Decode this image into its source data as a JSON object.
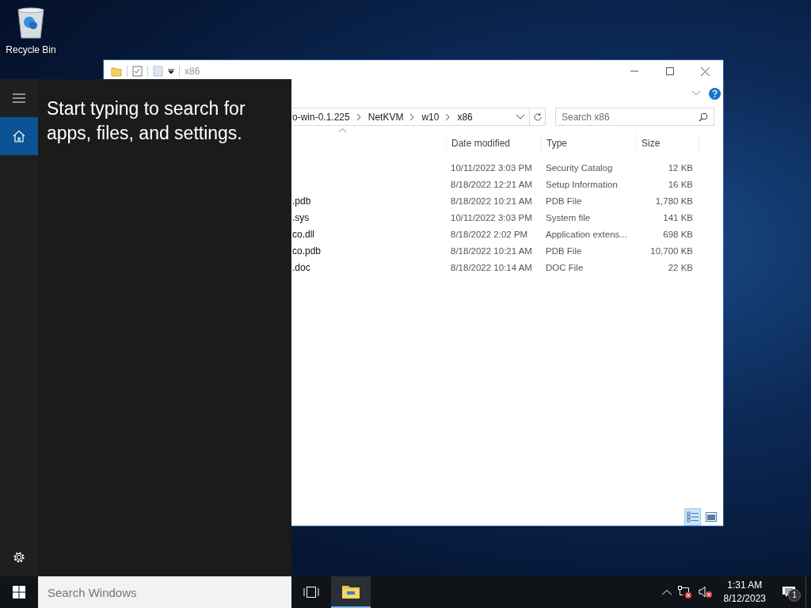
{
  "desktop": {
    "icons": [
      {
        "label": "Recycle Bin"
      }
    ]
  },
  "explorer": {
    "title": "x86",
    "breadcrumb": [
      "o-win-0.1.225",
      "NetKVM",
      "w10",
      "x86"
    ],
    "search": {
      "placeholder": "Search x86"
    },
    "columns": [
      "Date modified",
      "Type",
      "Size"
    ],
    "rows": [
      {
        "date": "10/11/2022 3:03 PM",
        "type": "Security Catalog",
        "size": "12 KB"
      },
      {
        "date": "8/18/2022 12:21 AM",
        "type": "Setup Information",
        "size": "16 KB"
      },
      {
        "name": ".pdb",
        "date": "8/18/2022 10:21 AM",
        "type": "PDB File",
        "size": "1,780 KB"
      },
      {
        "name": ".sys",
        "date": "10/11/2022 3:03 PM",
        "type": "System file",
        "size": "141 KB"
      },
      {
        "name": "co.dll",
        "date": "8/18/2022 2:02 PM",
        "type": "Application extens...",
        "size": "698 KB"
      },
      {
        "name": "co.pdb",
        "date": "8/18/2022 10:21 AM",
        "type": "PDB File",
        "size": "10,700 KB"
      },
      {
        "name": ".doc",
        "date": "8/18/2022 10:14 AM",
        "type": "DOC File",
        "size": "22 KB"
      }
    ],
    "view_modes": [
      {
        "kind": "details",
        "selected": true
      },
      {
        "kind": "large-icons",
        "selected": false
      }
    ]
  },
  "start_menu": {
    "nav": [
      {
        "kind": "menu",
        "selected": false
      },
      {
        "kind": "home",
        "selected": true
      }
    ],
    "prompt": "Start typing to search for apps, files, and settings."
  },
  "taskbar": {
    "search": {
      "placeholder": "Search Windows"
    },
    "apps": [
      {
        "kind": "task-view",
        "active": false
      },
      {
        "kind": "file-explorer",
        "active": true
      }
    ],
    "clock": {
      "time": "1:31 AM",
      "date": "8/12/2023"
    },
    "notifications": {
      "count": "1"
    }
  }
}
